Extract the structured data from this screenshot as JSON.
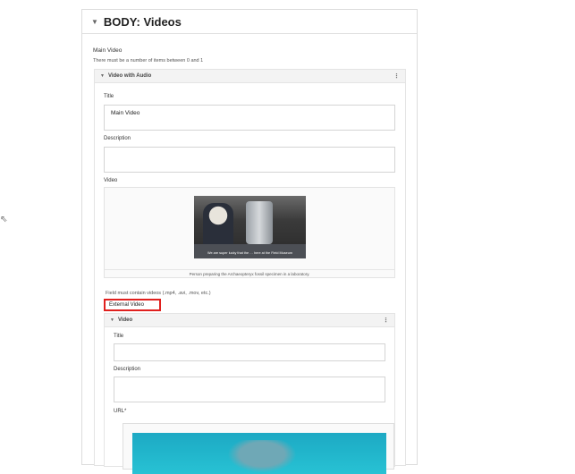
{
  "panel": {
    "title": "BODY: Videos"
  },
  "main_video": {
    "label": "Main Video",
    "constraint": "There must be a number of items between 0 and 1",
    "header": "Video with Audio",
    "title_label": "Title",
    "title_value": "Main Video",
    "description_label": "Description",
    "description_value": "",
    "video_label": "Video",
    "thumb_subtitle": "We are super lucky that the … here at the Field Museum",
    "caption": "Person preparing the Archaeopteryx fossil specimen in a laboratory.",
    "hint": "Field must contain videos (.mp4, .avi, .mov, etc.)"
  },
  "external_video": {
    "label": "External Video",
    "header": "Video",
    "title_label": "Title",
    "title_value": "",
    "description_label": "Description",
    "description_value": "",
    "url_label": "URL*"
  },
  "icons": {
    "caret": "chevron-down-icon",
    "kebab": "more-vertical-icon",
    "cursor": "mouse-pointer-icon"
  },
  "colors": {
    "highlight": "#e0201e",
    "border": "#dcdcdc",
    "header_bg": "#f3f3f3",
    "ocean": "#20b3ca"
  }
}
